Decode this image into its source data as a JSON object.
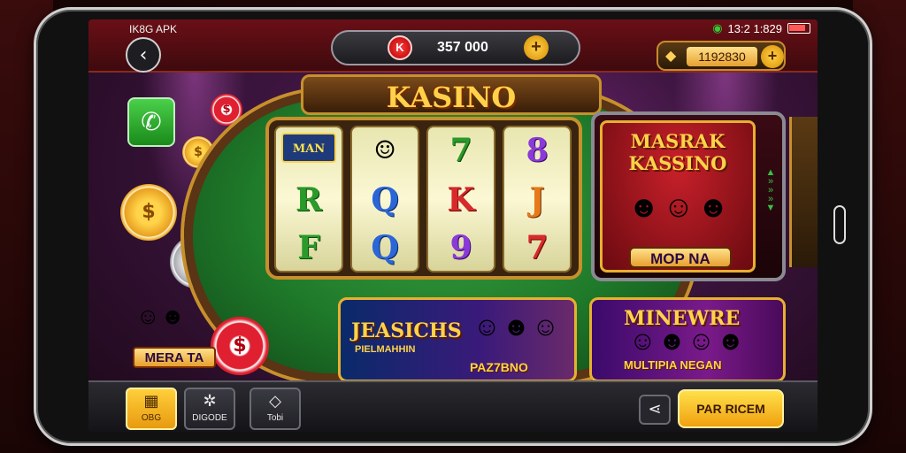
{
  "app": {
    "name": "IK8G APK"
  },
  "status": {
    "time": "13:2 1:829"
  },
  "header": {
    "balance": "357 000",
    "chip_symbol": "K",
    "gold_value": "1192830",
    "plus": "+"
  },
  "game": {
    "title": "KASINO"
  },
  "reels": [
    {
      "symbols": [
        "MAN",
        "R",
        "F"
      ]
    },
    {
      "symbols": [
        "☺",
        "Q",
        "Q"
      ]
    },
    {
      "symbols": [
        "7",
        "K",
        "9"
      ]
    },
    {
      "symbols": [
        "8",
        "J",
        "7"
      ]
    }
  ],
  "promo_main": {
    "title_line1": "MASRAK",
    "title_line2": "KASSINO",
    "subtitle": "MOP NA"
  },
  "card_jeasichs": {
    "title": "JEASICHS",
    "subtitle": "PIELMAHHIN",
    "caption": "PAZ7BNO"
  },
  "card_mineware": {
    "title": "MINEWRE",
    "caption": "MULTIPIA NEGAN"
  },
  "card_mera": {
    "label": "MERA TA"
  },
  "chips": {
    "left_gold": "$",
    "left_silver": "$",
    "red": "$"
  },
  "bottom_nav": [
    {
      "icon": "grid-icon",
      "label": "OBG"
    },
    {
      "icon": "puzzle-icon",
      "label": "DIGODE"
    },
    {
      "icon": "diamond-icon",
      "label": "Tobi"
    }
  ],
  "actions": {
    "cta_label": "PAR RICEM"
  },
  "colors": {
    "accent_gold": "#ffd24a",
    "felt_green": "#1f7a2a",
    "header_red": "#6a0f16"
  }
}
